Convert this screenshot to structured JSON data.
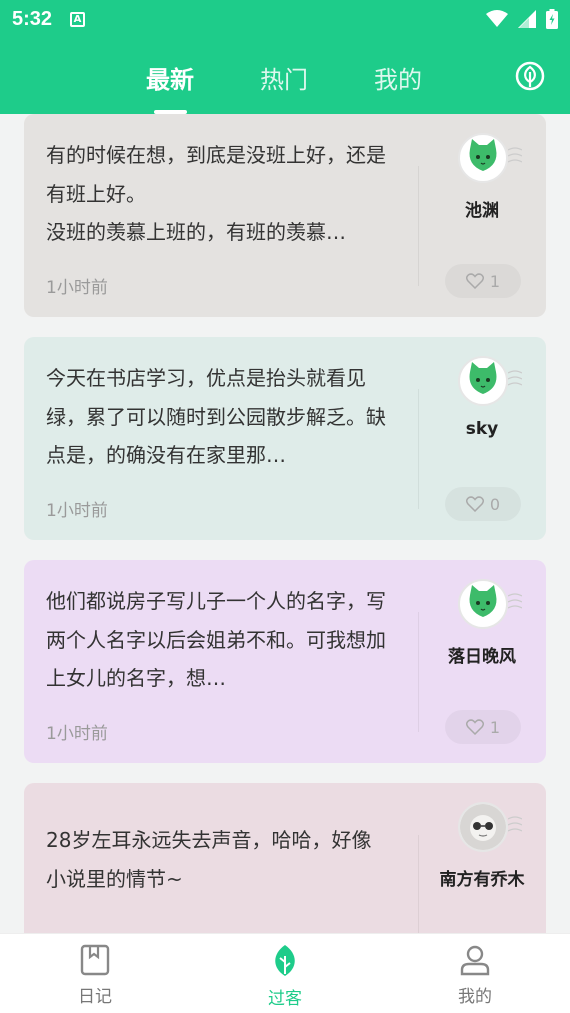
{
  "status_bar": {
    "time": "5:32",
    "notification_icon": "A",
    "icons": [
      "wifi-icon",
      "signal-icon",
      "battery-icon"
    ]
  },
  "top_tabs": {
    "tabs": [
      {
        "label": "最新",
        "active": true
      },
      {
        "label": "热门",
        "active": false
      },
      {
        "label": "我的",
        "active": false
      }
    ],
    "action_icon": "leaf-circle-icon"
  },
  "posts": [
    {
      "text": "有的时候在想，到底是没班上好，还是有班上好。\n没班的羡慕上班的，有班的羡慕…",
      "time": "1小时前",
      "username": "池渊",
      "likes": "1",
      "bg_color": "#e4e2e0",
      "avatar": "green-cat-avatar"
    },
    {
      "text": "今天在书店学习，优点是抬头就看见绿，累了可以随时到公园散步解乏。缺点是，的确没有在家里那…",
      "time": "1小时前",
      "username": "sky",
      "likes": "0",
      "bg_color": "#dfece9",
      "avatar": "green-cat-avatar"
    },
    {
      "text": "他们都说房子写儿子一个人的名字，写两个人名字以后会姐弟不和。可我想加上女儿的名字，想…",
      "time": "1小时前",
      "username": "落日晚风",
      "likes": "1",
      "bg_color": "#ecdcf4",
      "avatar": "green-cat-avatar"
    },
    {
      "text": "28岁左耳永远失去声音，哈哈，好像小说里的情节~",
      "time": "",
      "username": "南方有乔木",
      "likes": "",
      "bg_color": "#ebdce2",
      "avatar": "photo-avatar"
    }
  ],
  "bottom_nav": {
    "items": [
      {
        "label": "日记",
        "icon": "diary-icon",
        "active": false
      },
      {
        "label": "过客",
        "icon": "leaf-icon",
        "active": true
      },
      {
        "label": "我的",
        "icon": "user-icon",
        "active": false
      }
    ],
    "accent_color": "#1ecc8a"
  }
}
